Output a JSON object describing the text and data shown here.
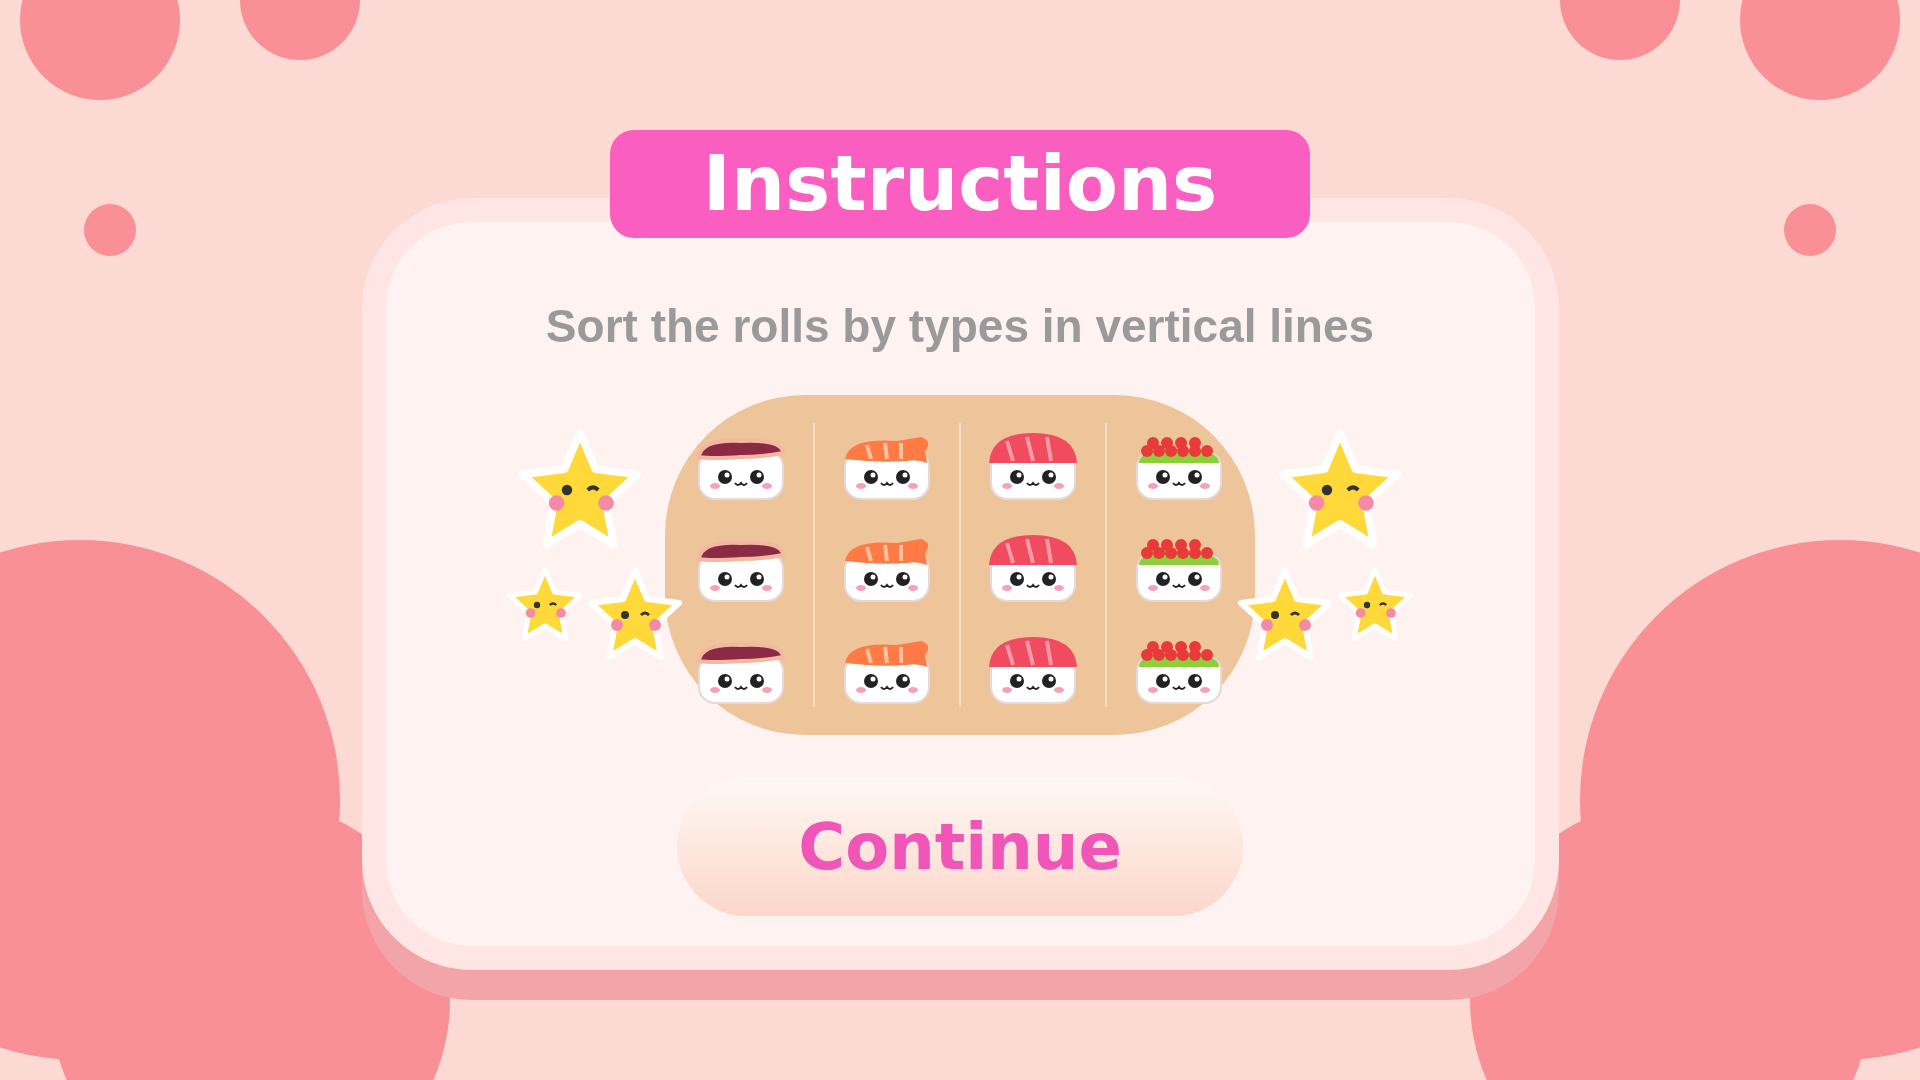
{
  "title": "Instructions",
  "instruction": "Sort the rolls by types in vertical lines",
  "board": {
    "columns": [
      {
        "pieces": [
          {
            "kind": "eel"
          },
          {
            "kind": "eel"
          },
          {
            "kind": "eel"
          }
        ]
      },
      {
        "pieces": [
          {
            "kind": "shrimp"
          },
          {
            "kind": "shrimp"
          },
          {
            "kind": "shrimp"
          }
        ]
      },
      {
        "pieces": [
          {
            "kind": "tuna"
          },
          {
            "kind": "tuna"
          },
          {
            "kind": "tuna"
          }
        ]
      },
      {
        "pieces": [
          {
            "kind": "roe"
          },
          {
            "kind": "roe"
          },
          {
            "kind": "roe"
          }
        ]
      }
    ]
  },
  "button": "Continue"
}
